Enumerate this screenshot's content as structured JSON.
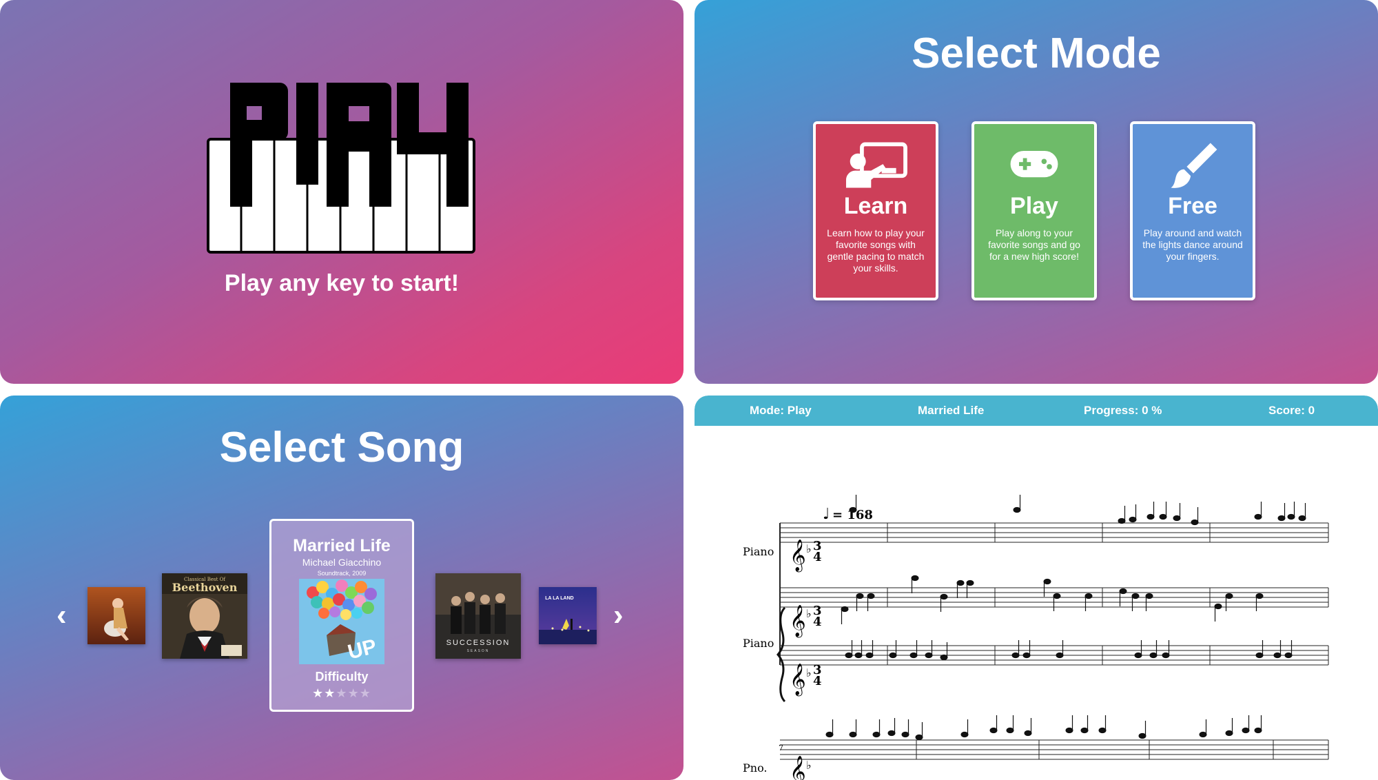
{
  "start_screen": {
    "logo_text": "PLAY",
    "prompt": "Play any key to start!"
  },
  "mode_screen": {
    "title": "Select Mode",
    "modes": [
      {
        "title": "Learn",
        "icon": "teacher-board-icon",
        "color": "#cd3f59",
        "description": "Learn how to play your favorite songs with gentle pacing to match your skills."
      },
      {
        "title": "Play",
        "icon": "gamepad-icon",
        "color": "#6ebb69",
        "description": "Play along to your favorite songs and go for a new high score!"
      },
      {
        "title": "Free",
        "icon": "paintbrush-icon",
        "color": "#5f93d7",
        "description": "Play around and watch the lights dance around your fingers."
      }
    ]
  },
  "song_screen": {
    "title": "Select Song",
    "prev_arrow": "‹",
    "next_arrow": "›",
    "albums": [
      {
        "cover_text": ""
      },
      {
        "cover_text": "Beethoven",
        "cover_subtext": "Classical Best Of"
      },
      {
        "cover_text": "SUCCESSION",
        "cover_subtext": "SEASON"
      },
      {
        "cover_text": "LA LA LAND"
      }
    ],
    "selected": {
      "title": "Married Life",
      "artist": "Michael Giacchino",
      "meta": "Soundtrack, 2009",
      "cover_text": "UP",
      "difficulty_label": "Difficulty",
      "difficulty_rating": 2,
      "difficulty_max": 5
    }
  },
  "game_screen": {
    "mode": "Mode: Play",
    "song": "Married Life",
    "progress": "Progress: 0 %",
    "score": "Score: 0",
    "tempo": "= 168",
    "staff_labels": [
      "Piano",
      "Piano",
      "Pno."
    ],
    "measure_number": "7"
  }
}
